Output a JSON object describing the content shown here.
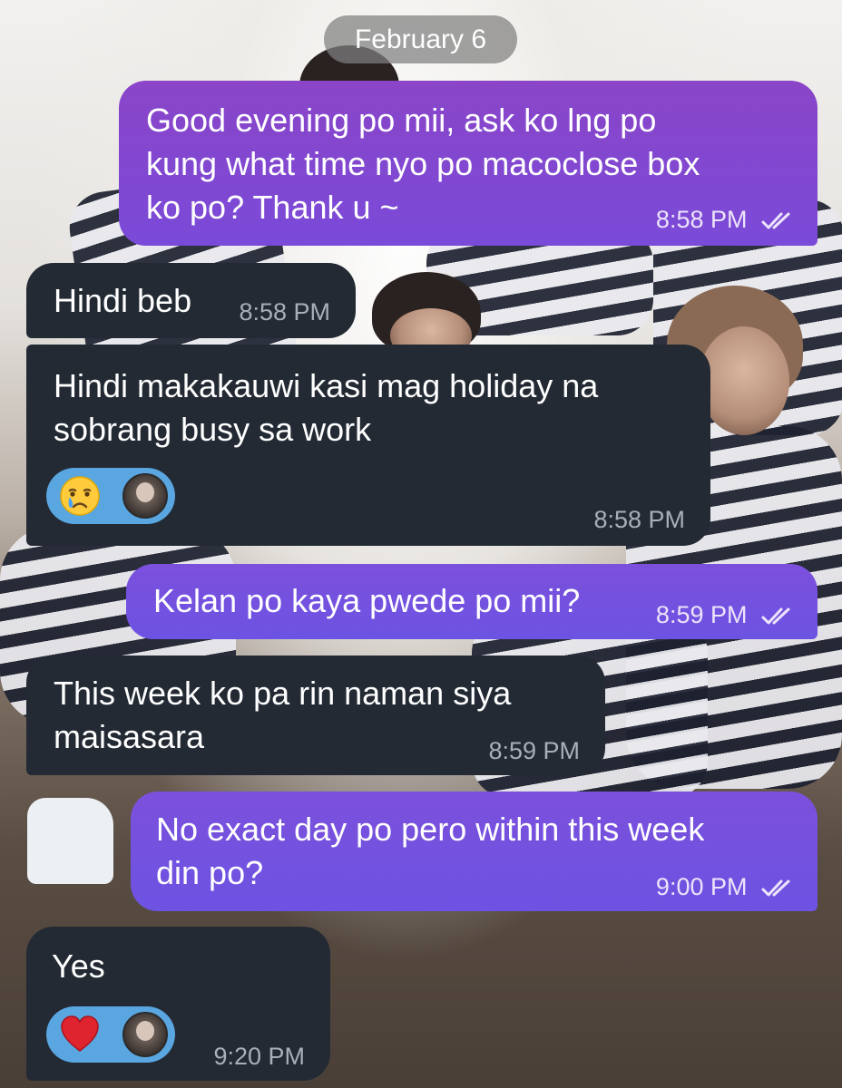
{
  "chat": {
    "date_label": "February 6",
    "messages": [
      {
        "direction": "outgoing",
        "text": "Good evening po mii, ask ko lng po\nkung what time nyo po macoclose box\nko po? Thank u ~",
        "time": "8:58 PM",
        "status": "read"
      },
      {
        "direction": "incoming",
        "text": "Hindi beb",
        "time": "8:58 PM"
      },
      {
        "direction": "incoming",
        "text": "Hindi makakauwi kasi mag holiday na\nsobrang busy sa work",
        "time": "8:58 PM",
        "reaction": {
          "emoji": "crying-face",
          "reactor": "avatar"
        }
      },
      {
        "direction": "outgoing",
        "text": "Kelan po kaya pwede po mii?",
        "time": "8:59 PM",
        "status": "read"
      },
      {
        "direction": "incoming",
        "text": "This week ko pa rin naman siya\nmaisasara",
        "time": "8:59 PM"
      },
      {
        "direction": "outgoing",
        "text": "No exact day po pero within this week\ndin po?",
        "time": "9:00 PM",
        "status": "read"
      },
      {
        "direction": "incoming",
        "text": "Yes",
        "time": "9:20 PM",
        "reaction": {
          "emoji": "red-heart",
          "reactor": "avatar"
        }
      }
    ]
  },
  "colors": {
    "outgoing_bubble": "#7a4ad8",
    "incoming_bubble": "#232a34",
    "reaction_pill": "#5aa6e0",
    "date_pill": "#808080"
  }
}
